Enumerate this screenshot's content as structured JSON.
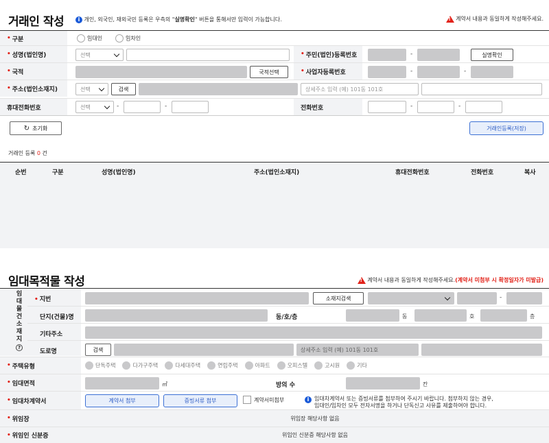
{
  "party": {
    "title": "거래인 작성",
    "notice_pre": "개인, 외국인, 재외국민 등록은 우측의 \"",
    "notice_bold": "실명확인",
    "notice_post": "\" 버튼을 통해서만 입력이 가능합니다.",
    "warning": "계약서 내용과 동일하게 작성해주세요.",
    "labels": {
      "type": "구분",
      "name": "성명(법인명)",
      "nationality": "국적",
      "address": "주소(법인소재지)",
      "mobile": "휴대전화번호",
      "resident_no": "주민(법인)등록번호",
      "business_no": "사업자등록번호",
      "phone": "전화번호"
    },
    "radio_landlord": "임대인",
    "radio_tenant": "임차인",
    "select_placeholder": "선택",
    "btn_verify": "실명확인",
    "btn_nation": "국적선택",
    "btn_search": "검색",
    "detail_placeholder": "상세주소 입력 (예) 101동 101호",
    "btn_reset": "초기화",
    "btn_register": "거래인등록(저장)",
    "count_label": "거래인 등록",
    "count_value": "0",
    "count_unit": "건",
    "columns": [
      "순번",
      "구분",
      "성명(법인명)",
      "주소(법인소재지)",
      "휴대전화번호",
      "전화번호",
      "복사"
    ]
  },
  "property": {
    "title": "임대목적물 작성",
    "warning": "계약서 내용과 동일하게 작성해주세요.",
    "warning_red": "(계약서 미첨부 시 확정일자가 미발급)",
    "vertical": [
      "임",
      "대",
      "물",
      "건",
      "소",
      "재",
      "지"
    ],
    "help_icon": "?",
    "labels": {
      "lot": "지번",
      "complex": "단지(건물)명",
      "other_addr": "기타주소",
      "road": "도로명",
      "dong_ho_floor": "동/호/층",
      "housing_type": "주택유형",
      "area": "임대면적",
      "rooms": "방의 수",
      "contract": "임대차계약서",
      "delegation": "위임장",
      "delegate_id": "위임인 신분증"
    },
    "btn_location_search": "소재지검색",
    "btn_search": "검색",
    "units": {
      "dong": "동",
      "ho": "호",
      "floor": "층",
      "area": "㎡",
      "room": "칸"
    },
    "detail_placeholder": "상세주소 입력 (예) 101동 101호",
    "housing_types": [
      "단독주택",
      "다가구주택",
      "다세대주택",
      "연립주택",
      "아파트",
      "오피스텔",
      "고시원",
      "기타"
    ],
    "btn_attach_contract": "계약서 첨부",
    "btn_attach_proof": "증빙서류 첨부",
    "checkbox_no_contract": "계약서미첨부",
    "contract_note_1": "임대차계약서 또는 증빙서류를 첨부하여 주시기 바랍니다. 첨부하지 않는 경우,",
    "contract_note_2": "임대인/임차인 모두 전자서명을 하거나 단독신고 사유를 제출하여야 합니다.",
    "delegation_value": "위임장 해당사항 없음",
    "delegate_id_value": "위임인 신분증 해당사항 없음"
  },
  "colors": {
    "accent": "#1a5ad8",
    "warning": "#e2231a",
    "label_bg": "#f2f3f5",
    "disabled": "#c9c9cb"
  }
}
